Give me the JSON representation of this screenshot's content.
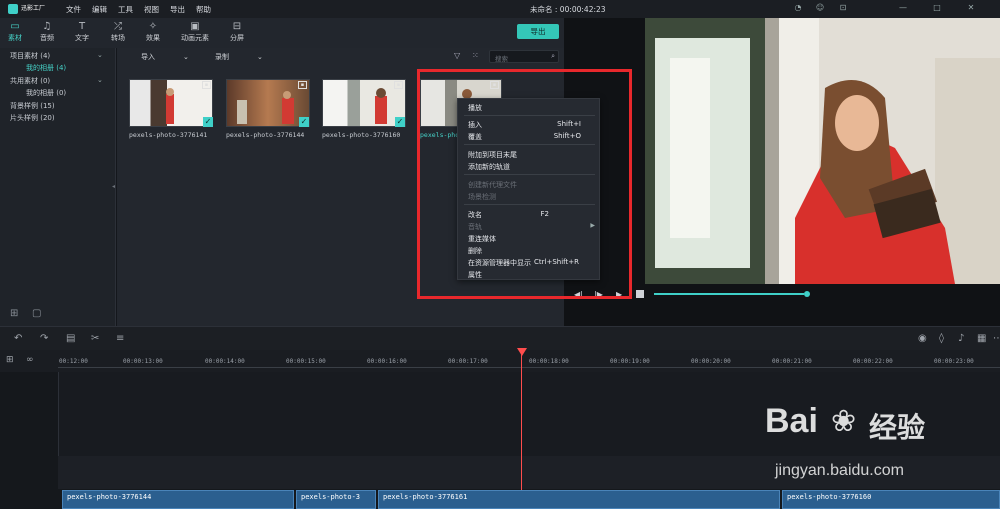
{
  "app": {
    "logo_text": "迅影工厂",
    "title": "未命名 : 00:00:42:23"
  },
  "menu": [
    "文件",
    "编辑",
    "工具",
    "视图",
    "导出",
    "帮助"
  ],
  "toolbar": [
    {
      "label": "素材",
      "icon": "folder-icon",
      "active": true
    },
    {
      "label": "音频",
      "icon": "music-icon",
      "active": false
    },
    {
      "label": "文字",
      "icon": "text-icon",
      "active": false
    },
    {
      "label": "转场",
      "icon": "transition-icon",
      "active": false
    },
    {
      "label": "效果",
      "icon": "effects-icon",
      "active": false
    },
    {
      "label": "动画元素",
      "icon": "image-icon",
      "active": false
    },
    {
      "label": "分屏",
      "icon": "split-screen-icon",
      "active": false
    }
  ],
  "export_label": "导出",
  "sidebar": [
    {
      "label": "项目素材 (4)"
    },
    {
      "label": "我的相册 (4)",
      "active": true
    },
    {
      "label": "共用素材 (0)"
    },
    {
      "label": "我的相册 (0)"
    },
    {
      "label": "背景样例 (15)"
    },
    {
      "label": "片头样例 (20)"
    }
  ],
  "media_filters": {
    "import": "导入",
    "record": "录制",
    "search_placeholder": "搜索"
  },
  "thumbs": [
    {
      "label": "pexels-photo-3776141"
    },
    {
      "label": "pexels-photo-3776144"
    },
    {
      "label": "pexels-photo-3776160"
    },
    {
      "label": "pexels-photo"
    }
  ],
  "context_menu": [
    {
      "label": "播放",
      "shortcut": "",
      "disabled": false
    },
    {
      "label": "插入",
      "shortcut": "Shift+I",
      "disabled": false
    },
    {
      "label": "覆盖",
      "shortcut": "Shift+O",
      "disabled": false
    },
    {
      "label": "附加到项目末尾",
      "shortcut": "",
      "disabled": false
    },
    {
      "label": "添加新的轨道",
      "shortcut": "",
      "disabled": false
    },
    {
      "label": "创建新代理文件",
      "shortcut": "",
      "disabled": true
    },
    {
      "label": "场景检测",
      "shortcut": "",
      "disabled": true
    },
    {
      "label": "改名",
      "shortcut": "F2",
      "disabled": false
    },
    {
      "label": "音轨",
      "shortcut": "",
      "disabled": true
    },
    {
      "label": "重连媒体",
      "shortcut": "",
      "disabled": false
    },
    {
      "label": "删除",
      "shortcut": "",
      "disabled": false
    },
    {
      "label": "在资源管理器中显示",
      "shortcut": "Ctrl+Shift+R",
      "disabled": false
    },
    {
      "label": "属性",
      "shortcut": "",
      "disabled": false
    }
  ],
  "ruler_ticks": [
    "00:12:00",
    "00:00:13:00",
    "00:00:14:00",
    "00:00:15:00",
    "00:00:16:00",
    "00:00:17:00",
    "00:00:18:00",
    "00:00:19:00",
    "00:00:20:00",
    "00:00:21:00",
    "00:00:22:00",
    "00:00:23:00"
  ],
  "clips": [
    {
      "label": "pexels-photo-3776144"
    },
    {
      "label": "pexels-photo-3"
    },
    {
      "label": "pexels-photo-3776161"
    },
    {
      "label": "pexels-photo-3776160"
    }
  ],
  "watermark": {
    "brand": "Bai",
    "brand2": "经验",
    "url": "jingyan.baidu.com"
  },
  "colors": {
    "accent": "#3fd0c8",
    "highlight": "#e8282c",
    "playhead": "#ff4d4d"
  }
}
